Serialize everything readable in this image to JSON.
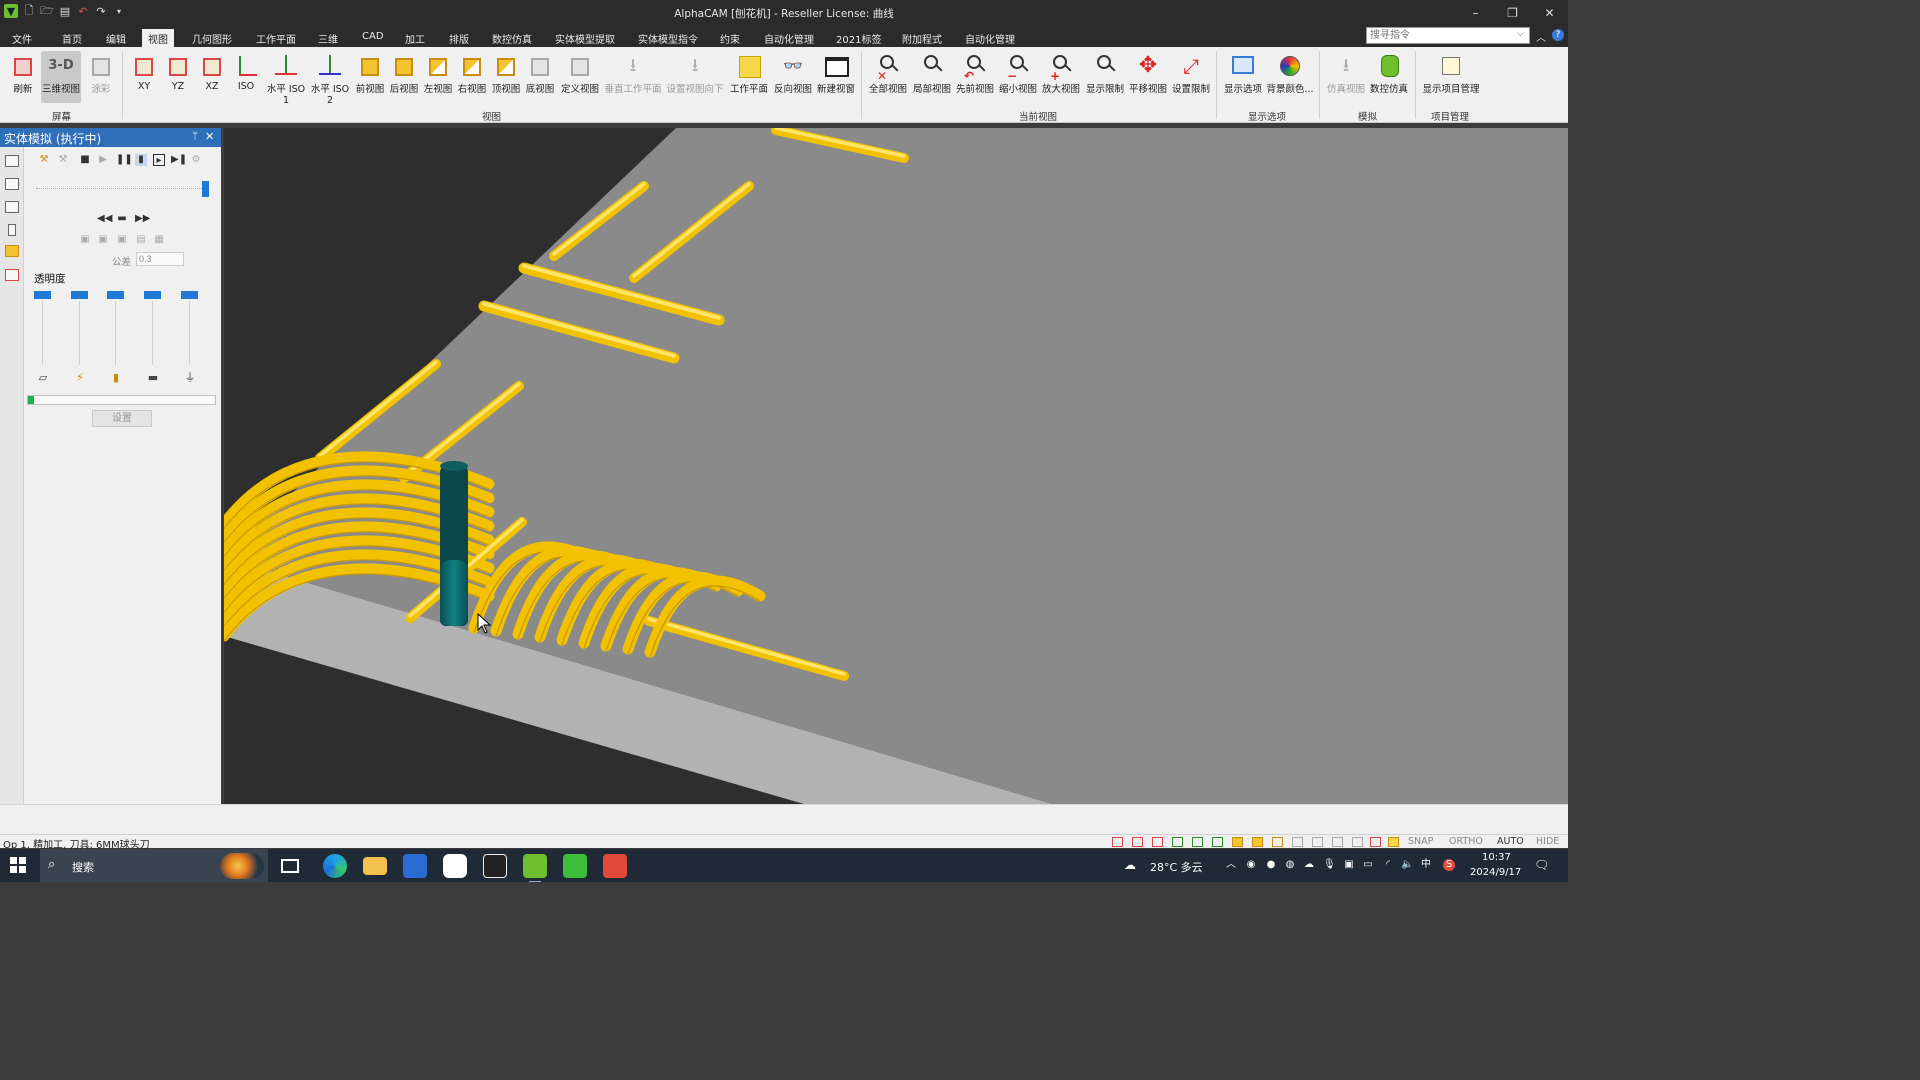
{
  "window": {
    "title": "AlphaCAM [刨花机] - Reseller License: 曲线",
    "minimize": "–",
    "restore": "❐",
    "close": "✕"
  },
  "quick_access": [
    "app-logo",
    "new-file-icon",
    "open-folder-icon",
    "save-icon",
    "undo-icon",
    "redo-icon",
    "customize-icon"
  ],
  "menu": {
    "tabs": [
      "文件",
      "首页",
      "编辑",
      "视图",
      "几何图形",
      "工作平面",
      "三维",
      "CAD",
      "加工",
      "排版",
      "数控仿真",
      "实体模型提取",
      "实体模型指令",
      "约束",
      "自动化管理",
      "2021标签",
      "附加程式",
      "自动化管理"
    ],
    "active": "视图",
    "search_placeholder": "搜寻指令"
  },
  "ribbon": {
    "groups": {
      "screen": "屏幕",
      "view": "视图",
      "current_view": "当前视图",
      "display_options": "显示选项",
      "simulate": "模拟",
      "project_mgmt": "项目管理"
    },
    "buttons": {
      "refresh": "刷新",
      "view3d": "三维视图",
      "view3d_glyph": "3-D",
      "shade": "涂彩",
      "xy": "XY",
      "yz": "YZ",
      "xz": "XZ",
      "iso": "ISO",
      "hiso1_a": "水平 ISO",
      "hiso1_b": "1",
      "hiso2_a": "水平 ISO",
      "hiso2_b": "2",
      "front": "前视图",
      "back": "后视图",
      "left": "左视图",
      "right": "右视图",
      "top": "顶视图",
      "bottom": "底视图",
      "custom": "定义视图",
      "vert_wp": "垂直工作平面",
      "set_view_down": "设置视图向下",
      "workplane": "工作平面",
      "reverse": "反向视图",
      "new_window": "新建视窗",
      "all": "全部视图",
      "partial": "局部视图",
      "previous": "先前视图",
      "zoom_out": "缩小视图",
      "zoom_in": "放大视图",
      "show_limits": "显示限制",
      "pan": "平移视图",
      "set_limits": "设置限制",
      "display_opts": "显示选项",
      "bg_color": "背景颜色...",
      "sim_view": "仿真视图",
      "nc_sim": "数控仿真",
      "proj_mgmt": "显示项目管理"
    }
  },
  "panel": {
    "title": "实体模拟 (执行中)",
    "pin": "ᛘ",
    "close": "✕",
    "rewind": "◀◀",
    "stop_glyph": "▬",
    "ffwd": "▶▶",
    "tolerance_label": "公差",
    "tolerance_value": "0.3",
    "transparency_label": "透明度",
    "transparency_levels": [
      1,
      1,
      1,
      1,
      1
    ],
    "progress": 0.03,
    "settings_button": "设置"
  },
  "status": {
    "text": "Op 1, 精加工, 刀具: 6MM球头刀",
    "snap": "SNAP",
    "ortho": "ORTHO",
    "auto": "AUTO",
    "hide": "HIDE"
  },
  "taskbar": {
    "search_text": "搜索",
    "weather": "28°C 多云",
    "time": "10:37",
    "date": "2024/9/17",
    "ime": "中",
    "apps": [
      "task-view",
      "edge",
      "file-explorer",
      "app-blue",
      "app-pinwheel",
      "app-dark",
      "alphacam",
      "app-green",
      "app-red"
    ]
  },
  "colors": {
    "accent_blue": "#2f6fba",
    "toolpath_yellow": "#f2c200",
    "tool_teal": "#0f6e70",
    "progress_green": "#22b14c"
  }
}
